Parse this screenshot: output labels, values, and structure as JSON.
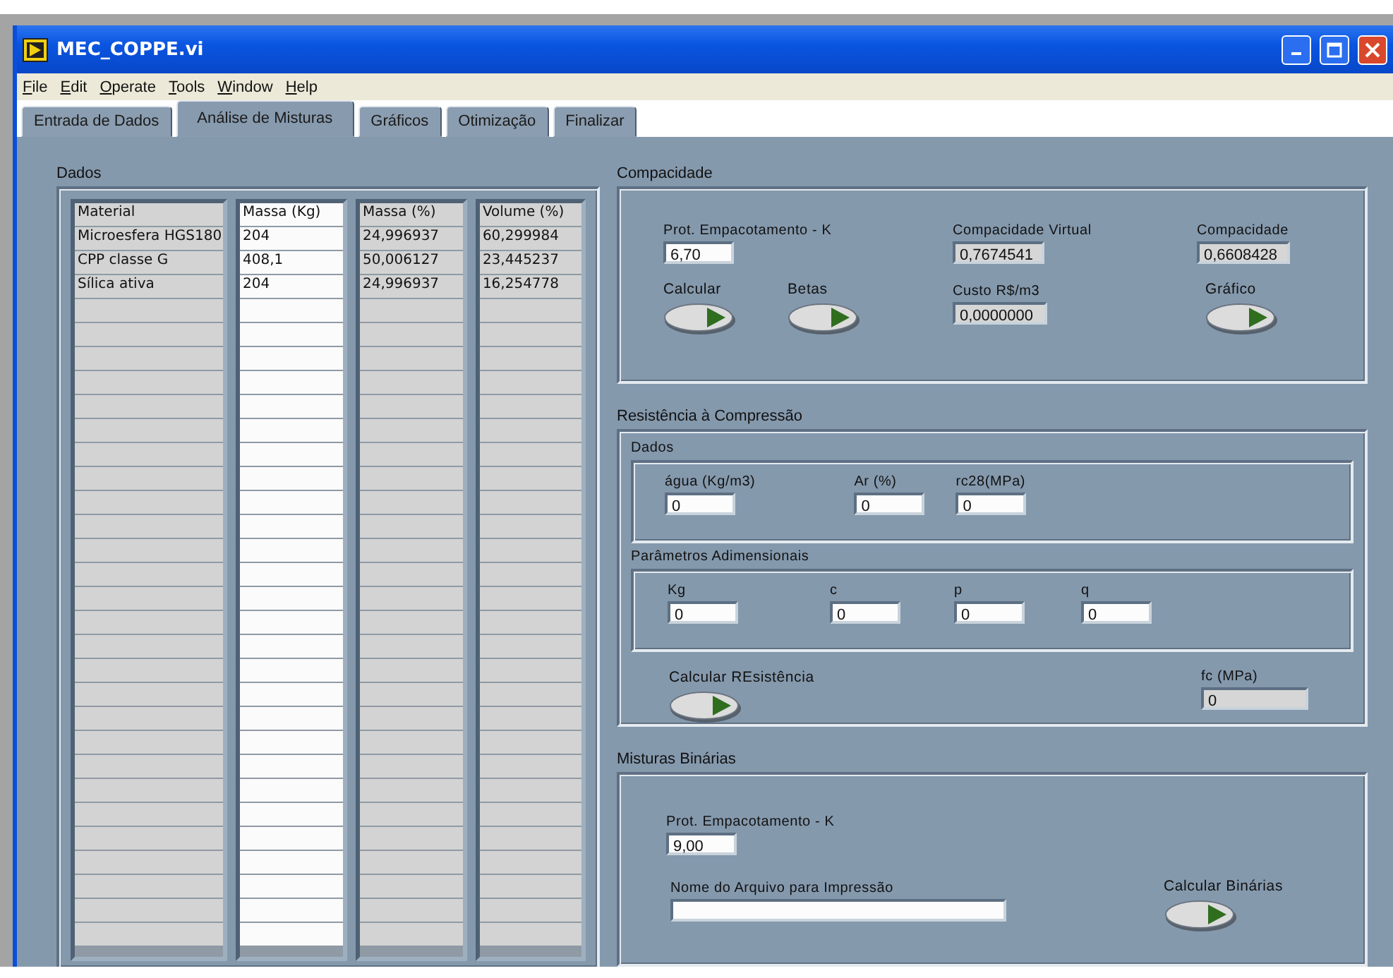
{
  "window": {
    "title": "MEC_COPPE.vi"
  },
  "menu": [
    "File",
    "Edit",
    "Operate",
    "Tools",
    "Window",
    "Help"
  ],
  "tabs": [
    {
      "label": "Entrada de Dados",
      "selected": false
    },
    {
      "label": "Análise de Misturas",
      "selected": true
    },
    {
      "label": "Gráficos",
      "selected": false
    },
    {
      "label": "Otimização",
      "selected": false
    },
    {
      "label": "Finalizar",
      "selected": false
    }
  ],
  "dados": {
    "title": "Dados",
    "columns": [
      {
        "header": "Material",
        "kind": "indicator"
      },
      {
        "header": "Massa (Kg)",
        "kind": "control"
      },
      {
        "header": "Massa (%)",
        "kind": "indicator"
      },
      {
        "header": "Volume (%)",
        "kind": "indicator"
      }
    ],
    "rows": [
      [
        "Microesfera HGS180",
        "204",
        "24,996937",
        "60,299984"
      ],
      [
        "CPP classe G",
        "408,1",
        "50,006127",
        "23,445237"
      ],
      [
        "Sílica ativa",
        "204",
        "24,996937",
        "16,254778"
      ]
    ]
  },
  "compacidade": {
    "title": "Compacidade",
    "fields": [
      {
        "label": "Prot. Empacotamento - K",
        "value": "6,70",
        "kind": "control"
      },
      {
        "label": "Compacidade Virtual",
        "value": "0,7674541",
        "kind": "indicator"
      },
      {
        "label": "Compacidade",
        "value": "0,6608428",
        "kind": "indicator"
      },
      {
        "label": "Custo R$/m3",
        "value": "0,0000000",
        "kind": "indicator"
      }
    ],
    "buttons": [
      {
        "label": "Calcular"
      },
      {
        "label": "Betas"
      },
      {
        "label": "Gráfico"
      }
    ]
  },
  "resistencia": {
    "title": "Resistência à Compressão",
    "dados": {
      "title": "Dados",
      "fields": [
        {
          "label": "água (Kg/m3)",
          "value": "0",
          "kind": "control"
        },
        {
          "label": "Ar (%)",
          "value": "0",
          "kind": "control"
        },
        {
          "label": "rc28(MPa)",
          "value": "0",
          "kind": "control"
        }
      ]
    },
    "parametros": {
      "title": "Parâmetros Adimensionais",
      "fields": [
        {
          "label": "Kg",
          "value": "0",
          "kind": "control"
        },
        {
          "label": "c",
          "value": "0",
          "kind": "control"
        },
        {
          "label": "p",
          "value": "0",
          "kind": "control"
        },
        {
          "label": "q",
          "value": "0",
          "kind": "control"
        }
      ]
    },
    "button": {
      "label": "Calcular REsistência"
    },
    "result": {
      "label": "fc (MPa)",
      "value": "0",
      "kind": "indicator"
    }
  },
  "binarias": {
    "title": "Misturas Binárias",
    "fields": [
      {
        "label": "Prot. Empacotamento - K",
        "value": "9,00",
        "kind": "control"
      },
      {
        "label": "Nome do Arquivo para Impressão",
        "kind": "control"
      }
    ],
    "button": {
      "label": "Calcular Binárias"
    }
  }
}
